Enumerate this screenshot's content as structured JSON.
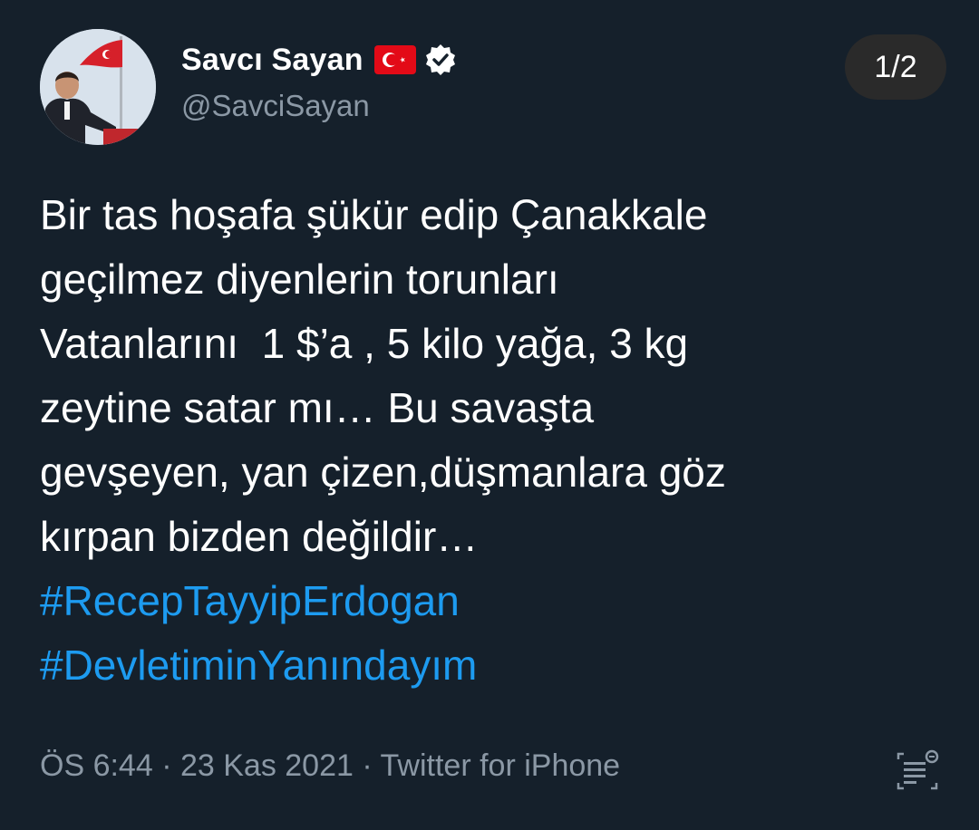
{
  "author": {
    "display_name": "Savcı Sayan",
    "handle": "@SavciSayan",
    "flag_icon": "turkey-flag-icon",
    "verified_icon": "verified-badge-icon"
  },
  "pager": {
    "label": "1/2"
  },
  "tweet": {
    "lines": [
      "Bir tas hoşafa şükür edip Çanakkale",
      "geçilmez diyenlerin torunları",
      "Vatanlarını  1 $’a , 5 kilo yağa, 3 kg",
      "zeytine satar mı… Bu savaşta",
      "gevşeyen, yan çizen,düşmanlara göz",
      "kırpan bizden değildir…"
    ],
    "hashtags": [
      "#RecepTayyipErdogan",
      "#DevletiminYanındayım"
    ]
  },
  "meta": {
    "time": "ÖS 6:44",
    "separator": " · ",
    "date": "23 Kas 2021",
    "source": "Twitter for iPhone"
  },
  "colors": {
    "background": "#15202b",
    "text": "#ffffff",
    "muted": "#8b98a5",
    "link": "#1d9bf0",
    "pager_bg": "#2a2a2a"
  }
}
